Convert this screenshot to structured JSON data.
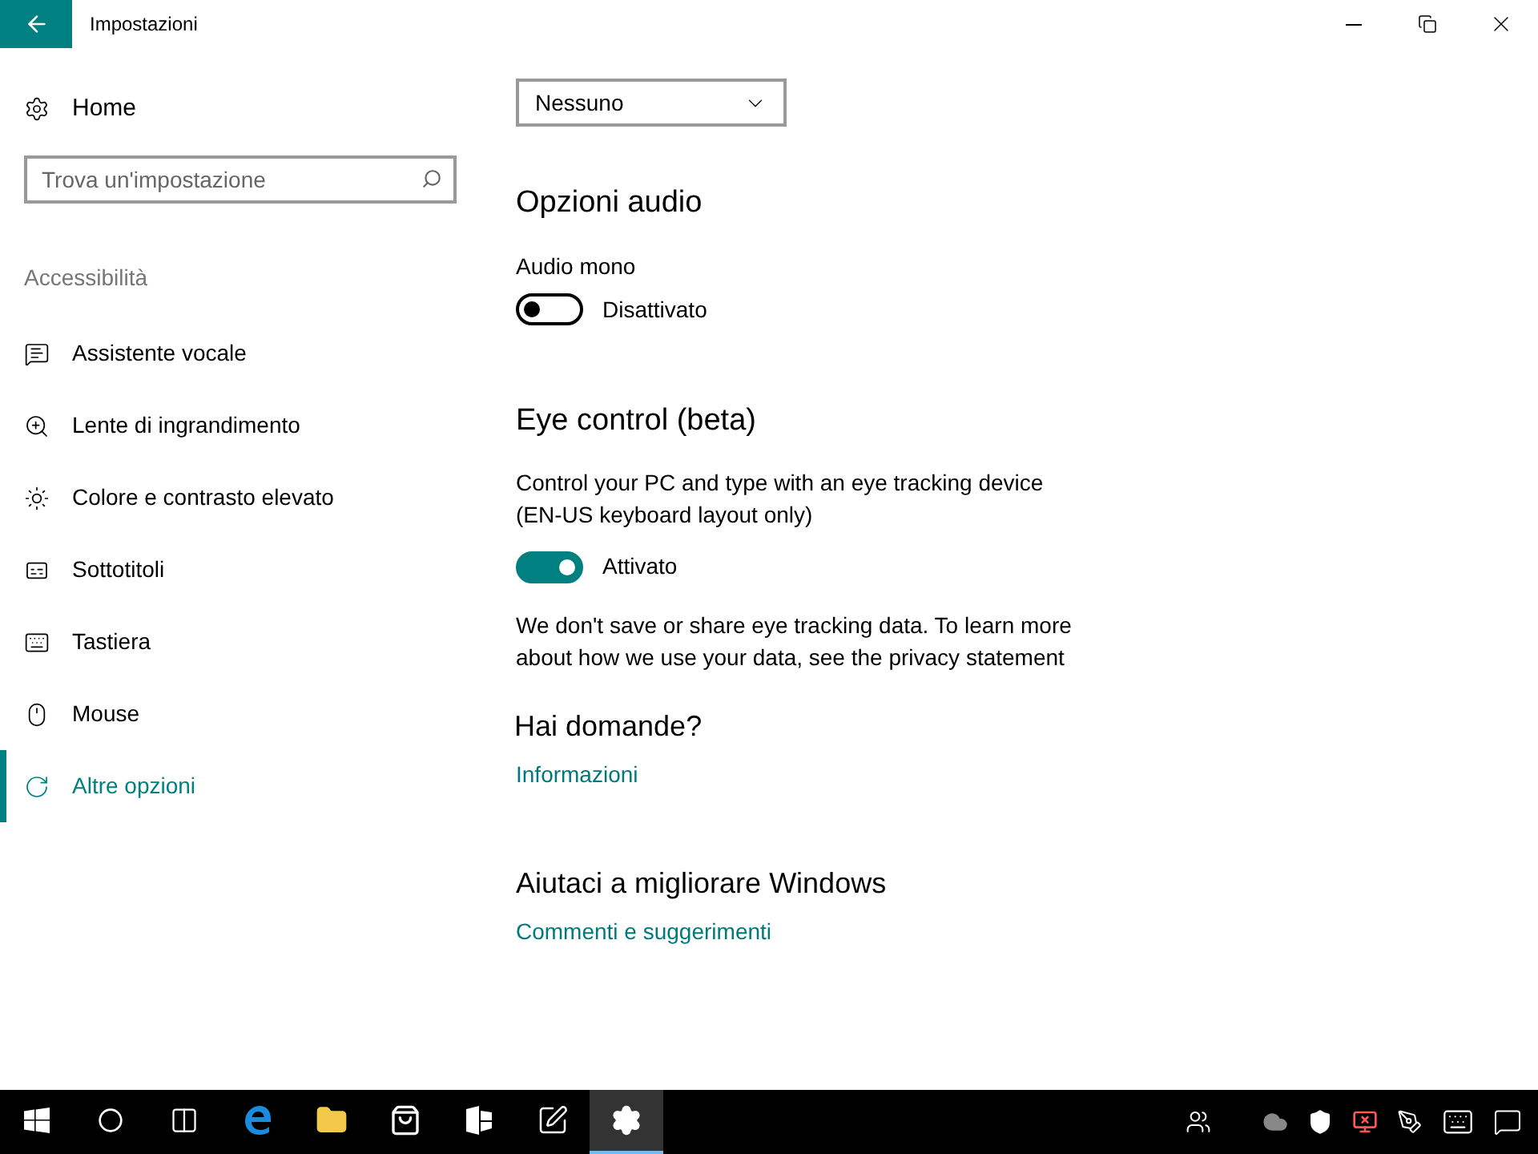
{
  "window": {
    "title": "Impostazioni"
  },
  "sidebar": {
    "home": "Home",
    "search": {
      "placeholder": "Trova un'impostazione"
    },
    "section": "Accessibilità",
    "items": [
      {
        "label": "Assistente vocale",
        "selected": false
      },
      {
        "label": "Lente di ingrandimento",
        "selected": false
      },
      {
        "label": "Colore e contrasto elevato",
        "selected": false
      },
      {
        "label": "Sottotitoli",
        "selected": false
      },
      {
        "label": "Tastiera",
        "selected": false
      },
      {
        "label": "Mouse",
        "selected": false
      },
      {
        "label": "Altre opzioni",
        "selected": true
      }
    ]
  },
  "content": {
    "dropdown": {
      "value": "Nessuno"
    },
    "audio": {
      "heading": "Opzioni audio",
      "label": "Audio mono",
      "toggle": {
        "on": false,
        "state": "Disattivato"
      }
    },
    "eye_control": {
      "heading": "Eye control (beta)",
      "description": "Control your PC and type with an eye tracking device (EN-US keyboard layout only)",
      "toggle": {
        "on": true,
        "state": "Attivato"
      },
      "note": "We don't save or share eye tracking data. To learn more about how we use your data, see the privacy statement"
    },
    "help": {
      "heading": "Hai domande?",
      "link": "Informazioni"
    },
    "improve": {
      "heading": "Aiutaci a migliorare Windows",
      "link": "Commenti e suggerimenti"
    }
  },
  "taskbar": {
    "apps": [
      {
        "selected": false
      },
      {
        "selected": false
      },
      {
        "selected": false
      },
      {
        "selected": false
      },
      {
        "selected": false
      },
      {
        "selected": false
      },
      {
        "selected": false
      },
      {
        "selected": false
      },
      {
        "selected": true
      }
    ]
  }
}
